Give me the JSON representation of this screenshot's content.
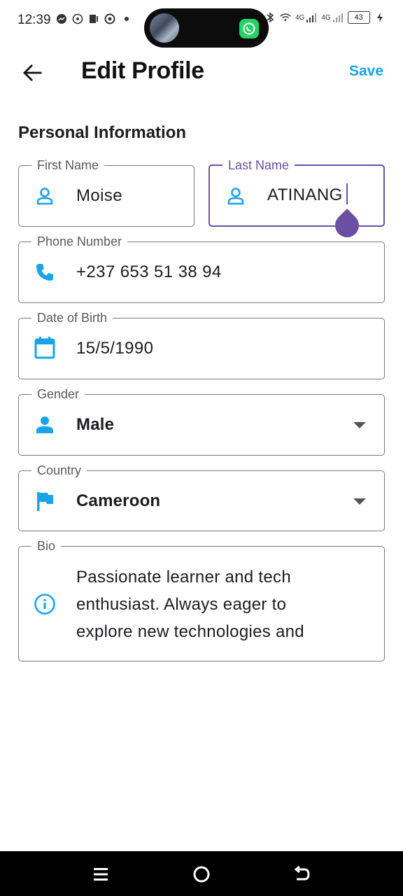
{
  "status_bar": {
    "time": "12:39",
    "network_1": "4G",
    "network_2": "4G",
    "battery": "43"
  },
  "app_bar": {
    "title": "Edit Profile",
    "save_label": "Save"
  },
  "section": {
    "title": "Personal Information"
  },
  "fields": {
    "first_name": {
      "label": "First Name",
      "value": "Moise",
      "icon": "person-outline-icon"
    },
    "last_name": {
      "label": "Last Name",
      "value": "ATINANG",
      "icon": "person-outline-icon"
    },
    "phone": {
      "label": "Phone Number",
      "value": "+237 653 51 38 94",
      "icon": "phone-icon"
    },
    "dob": {
      "label": "Date of Birth",
      "value": "15/5/1990",
      "icon": "calendar-icon"
    },
    "gender": {
      "label": "Gender",
      "value": "Male",
      "icon": "person-icon"
    },
    "country": {
      "label": "Country",
      "value": "Cameroon",
      "icon": "flag-icon"
    },
    "bio": {
      "label": "Bio",
      "value": "Passionate learner and tech enthusiast. Always eager to explore new technologies and",
      "icon": "info-icon"
    }
  },
  "colors": {
    "accent": "#1aa3e8",
    "focus": "#6a4fa3",
    "border": "#7a7a7a",
    "icon": "#1aa3e8"
  }
}
